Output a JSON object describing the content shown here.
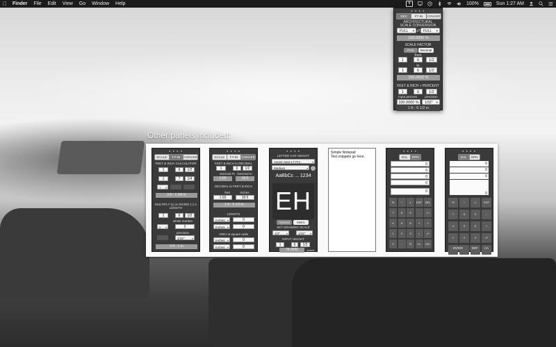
{
  "menubar": {
    "apple": "",
    "items": [
      "Finder",
      "File",
      "Edit",
      "View",
      "Go",
      "Window",
      "Help"
    ],
    "app_icon_label": "ft",
    "battery": "100%",
    "clock": "Sun 1:27 AM"
  },
  "main_panel": {
    "tabs": [
      "DEC",
      "FT-IN",
      "CONVERT"
    ],
    "title1": "ARCHITECTURAL",
    "title2": "SCALE CONVERSION",
    "scale_from": "FULL",
    "scale_to": "FULL",
    "scale_pct": "100.0000 %",
    "scale_factor_label": "SCALE FACTOR",
    "sf_tabs": [
      "Ft-In",
      "Decimal"
    ],
    "from_label": "from",
    "from_a": "1",
    "from_b": "6",
    "from_c": "1/2",
    "to_label": "to",
    "to_a": "1",
    "to_b": "6",
    "to_c": "1/2",
    "sf_result": "100.0000 %",
    "fip_label": "FEET & INCH + PERCENT",
    "fip_a": "1",
    "fip_b": "6",
    "fip_c": "1/2",
    "input_percent_label": "input percent",
    "precision_label": "precision",
    "pct_input": "100.0000 %",
    "precision_value": "1/32\"",
    "fip_result": "1 ft - 6 1/2 in"
  },
  "others_title": "Other panels included:",
  "panel1": {
    "tabs": [
      "SCALE",
      "FT-IN",
      "CONVER..."
    ],
    "h1": "FEET & INCH CALCULATOR",
    "r1": [
      "1",
      "6",
      "1/2"
    ],
    "r2": [
      "1",
      "7",
      "1/4"
    ],
    "op": "+",
    "res1": "3 ft - 1 3/4 in",
    "h2": "MULTIPLY (x) or DIVIDE (÷) A LENGTH",
    "r3": [
      "1",
      "6",
      "1/2"
    ],
    "whole_label": "whole number",
    "mult_op": "x",
    "mult_val": "2",
    "prec_label": "precision",
    "prec": "1/32\"",
    "res2": "3 ft - 1 in"
  },
  "panel2": {
    "tabs": [
      "SCALE",
      "FT-IN",
      "CONVERT"
    ],
    "h1": "FEET & INCH to DECIMAL",
    "r1": [
      "1",
      "6",
      "1/2"
    ],
    "dec_ft_label": "Decimal Ft",
    "dec_in_label": "Decimal In",
    "dec_ft": "1.55",
    "dec_in": "18.5",
    "h2": "DECIMAL to FEET & INCH",
    "feet_label": "feet",
    "inches_label": "inches",
    "feet_val": "1.55",
    "inches_val": "18.5",
    "res": "1 ft - 6 1/2 in",
    "h3": "LENGTH",
    "unit1": "Inches",
    "unit2": "Inches",
    "h4": "AREA & square units",
    "unit3": "Inches",
    "unit4": "Inches",
    "v": "0"
  },
  "panel3": {
    "title": "LETTER CAP HEIGHT",
    "font": "Avenir Next LT Pro",
    "weight": "Medium",
    "sample": "AaBbCc ... 1234",
    "big": "EH",
    "mode_a": "Imperial",
    "mode_b": "Metric",
    "scale_label": "SET DRAWING SCALE",
    "s1": "1/2\"",
    "s2": "1/32\"",
    "input_label": "INPUT HEIGHT",
    "h_a": "1",
    "h_b": "6",
    "h_c": "1/2",
    "out": "78.3896",
    "unit": "points"
  },
  "notepad": {
    "line1": "Simple Notepad",
    "line2": "Text snippets go here."
  },
  "calc1": {
    "tabs": [
      "DAL",
      "RPN"
    ],
    "stack": [
      "0",
      "0",
      "0",
      "0"
    ],
    "display": "0",
    "keys": [
      "%",
      "÷",
      "x",
      "EXP",
      "DEL",
      "7",
      "8",
      "9",
      "-",
      "+/-",
      "4",
      "5",
      "6",
      "+",
      "√",
      "1",
      "2",
      "3",
      "=",
      "x²",
      "0",
      ".",
      "Ft",
      "In",
      "MC"
    ]
  },
  "calc2": {
    "tabs": [
      "DAL",
      "RPN"
    ],
    "stack": [
      "0",
      "0",
      "0",
      "0"
    ],
    "keys": [
      "%",
      "÷",
      "x",
      "EXP",
      "7",
      "8",
      "9",
      "-",
      "4",
      "5",
      "6",
      "+",
      "1",
      "2",
      "3",
      "x²",
      "0",
      ".",
      "Ft",
      "In"
    ],
    "enter": "ENTER",
    "drp": "DRP",
    "ca": "CA"
  }
}
